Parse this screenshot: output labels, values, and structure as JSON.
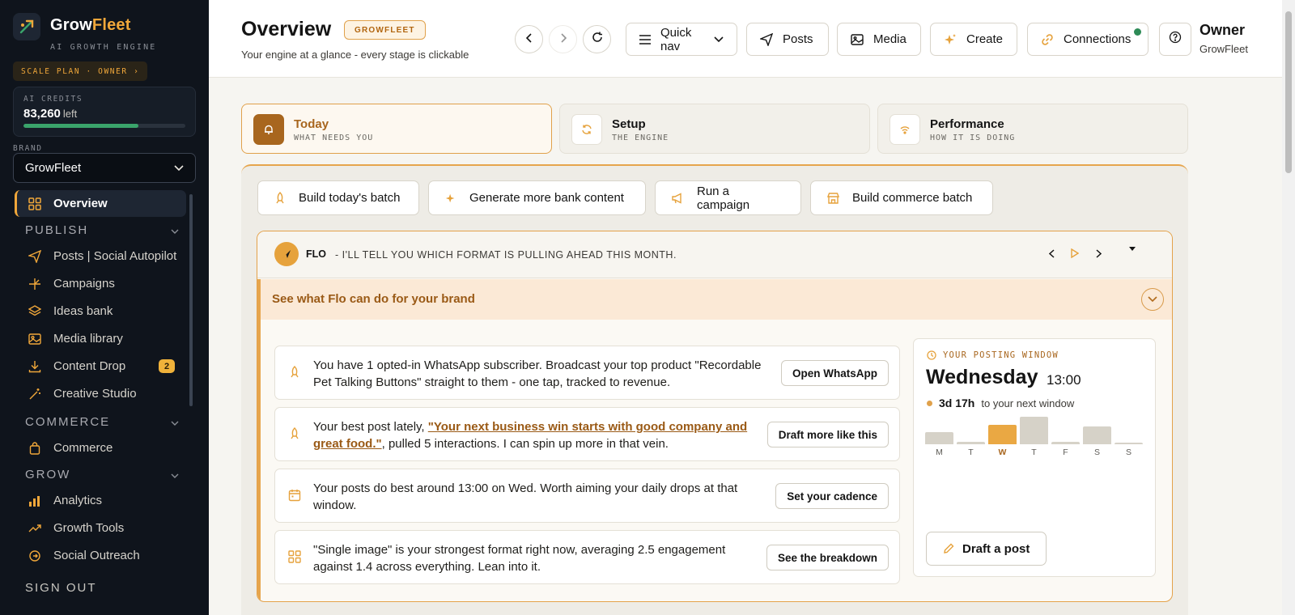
{
  "sidebar": {
    "brand_first": "Grow",
    "brand_second": "Fleet",
    "brand_tagline": "AI GROWTH ENGINE",
    "plan_pill": "SCALE PLAN · OWNER ›",
    "credits": {
      "label": "AI CREDITS",
      "value": "83,260",
      "suffix": "left",
      "fraction_used": 0.71
    },
    "brand_label": "BRAND",
    "brand_select_value": "GrowFleet",
    "overview_label": "Overview",
    "sections": {
      "publish": "PUBLISH",
      "commerce": "COMMERCE",
      "grow": "GROW"
    },
    "items": [
      {
        "label": "Posts | Social Autopilot",
        "icon": "send-icon"
      },
      {
        "label": "Campaigns",
        "icon": "sparkle-plus-icon"
      },
      {
        "label": "Ideas bank",
        "icon": "layers-icon"
      },
      {
        "label": "Media library",
        "icon": "image-icon"
      },
      {
        "label": "Content Drop",
        "icon": "download-icon",
        "badge": "2"
      },
      {
        "label": "Creative Studio",
        "icon": "magic-wand-icon"
      },
      {
        "label": "Commerce",
        "icon": "shopping-bag-icon"
      },
      {
        "label": "Analytics",
        "icon": "bar-chart-icon"
      },
      {
        "label": "Growth Tools",
        "icon": "trend-up-icon"
      },
      {
        "label": "Social Outreach",
        "icon": "outreach-icon"
      }
    ],
    "sign_out": "SIGN OUT"
  },
  "header": {
    "title": "Overview",
    "badge": "GROWFLEET",
    "subtitle": "Your engine at a glance - every stage is clickable",
    "buttons": {
      "quick_nav": "Quick nav",
      "posts": "Posts",
      "media": "Media",
      "create": "Create",
      "connections": "Connections"
    },
    "owner": "Owner",
    "owner_brand": "GrowFleet"
  },
  "stages": [
    {
      "title": "Today",
      "subtitle": "WHAT NEEDS YOU"
    },
    {
      "title": "Setup",
      "subtitle": "THE ENGINE"
    },
    {
      "title": "Performance",
      "subtitle": "HOW IT IS DOING"
    }
  ],
  "quick_actions": [
    "Build today's batch",
    "Generate more bank content",
    "Run a campaign",
    "Build commerce batch"
  ],
  "flo": {
    "name": "FLO",
    "message": "- I'LL TELL YOU WHICH FORMAT IS PULLING AHEAD THIS MONTH.",
    "banner": "See what Flo can do for your brand",
    "cards": [
      {
        "text": "You have 1 opted-in WhatsApp subscriber. Broadcast your top product \"Recordable Pet Talking Buttons\" straight to them - one tap, tracked to revenue.",
        "button": "Open WhatsApp"
      },
      {
        "text_before": "Your best post lately, ",
        "link": "\"Your next business win starts with good company and great food.\"",
        "text_after": ", pulled 5 interactions. I can spin up more in that vein.",
        "button": "Draft more like this"
      },
      {
        "text": "Your posts do best around 13:00 on Wed. Worth aiming your daily drops at that window.",
        "button": "Set your cadence"
      },
      {
        "text": "\"Single image\" is your strongest format right now, averaging 2.5 engagement against 1.4 across everything. Lean into it.",
        "button": "See the breakdown"
      }
    ],
    "window": {
      "label": "YOUR POSTING WINDOW",
      "day": "Wednesday",
      "time": "13:00",
      "countdown": "3d 17h",
      "countdown_suffix": "to your next window",
      "days": [
        "M",
        "T",
        "W",
        "T",
        "F",
        "S",
        "S"
      ],
      "levels": [
        0.45,
        0.08,
        0.72,
        1.0,
        0.08,
        0.65,
        0.07
      ],
      "highlight_index": 2,
      "button": "Draft a post"
    }
  },
  "colors": {
    "accent": "#f0a73a",
    "sidebar_bg": "#0f141c",
    "brown": "#a8661e",
    "success": "#3aa46b"
  }
}
